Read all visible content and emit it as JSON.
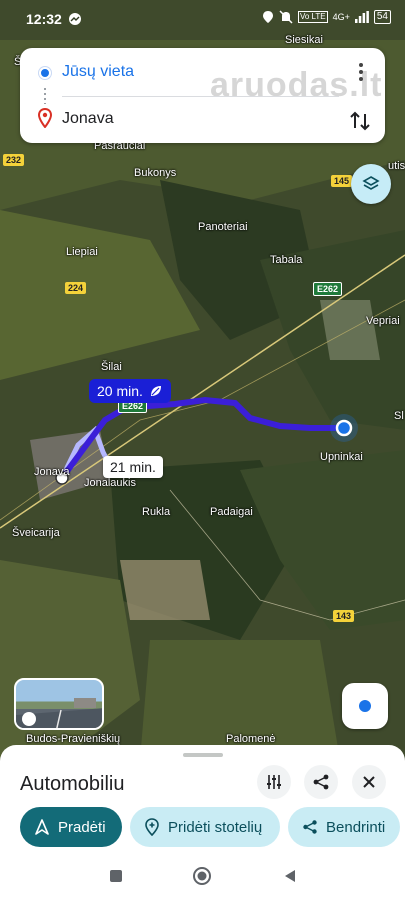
{
  "status": {
    "time": "12:32",
    "network": "Vo LTE",
    "signal": "4G+",
    "battery": "54"
  },
  "route": {
    "origin": "Jūsų vieta",
    "destination": "Jonava",
    "watermark": "aruodas.lt"
  },
  "map_labels": {
    "places": [
      "Siesikai",
      "Pasraučiai",
      "Bukonys",
      "Panoteriai",
      "Liepiai",
      "Tabala",
      "Vepriai",
      "Šilai",
      "Jonava",
      "Jonalaukis",
      "Upninkai",
      "Rukla",
      "Padaigai",
      "Šveicarija",
      "Budos-Pravieniškių",
      "Palomenė",
      "Sl",
      "Šl",
      "utis"
    ],
    "roads": [
      "232",
      "145",
      "224",
      "E262",
      "E262",
      "143"
    ]
  },
  "route_times": {
    "primary": "20 min.",
    "alternative": "21 min."
  },
  "sheet": {
    "title": "Automobiliu",
    "buttons": {
      "start": "Pradėti",
      "add_stop": "Pridėti stotelių",
      "share": "Bendrinti"
    }
  },
  "colors": {
    "route_primary": "#3b1fd8",
    "accent_teal": "#136b78",
    "light_teal": "#c9ecf4",
    "user_blue": "#1a73e8"
  }
}
